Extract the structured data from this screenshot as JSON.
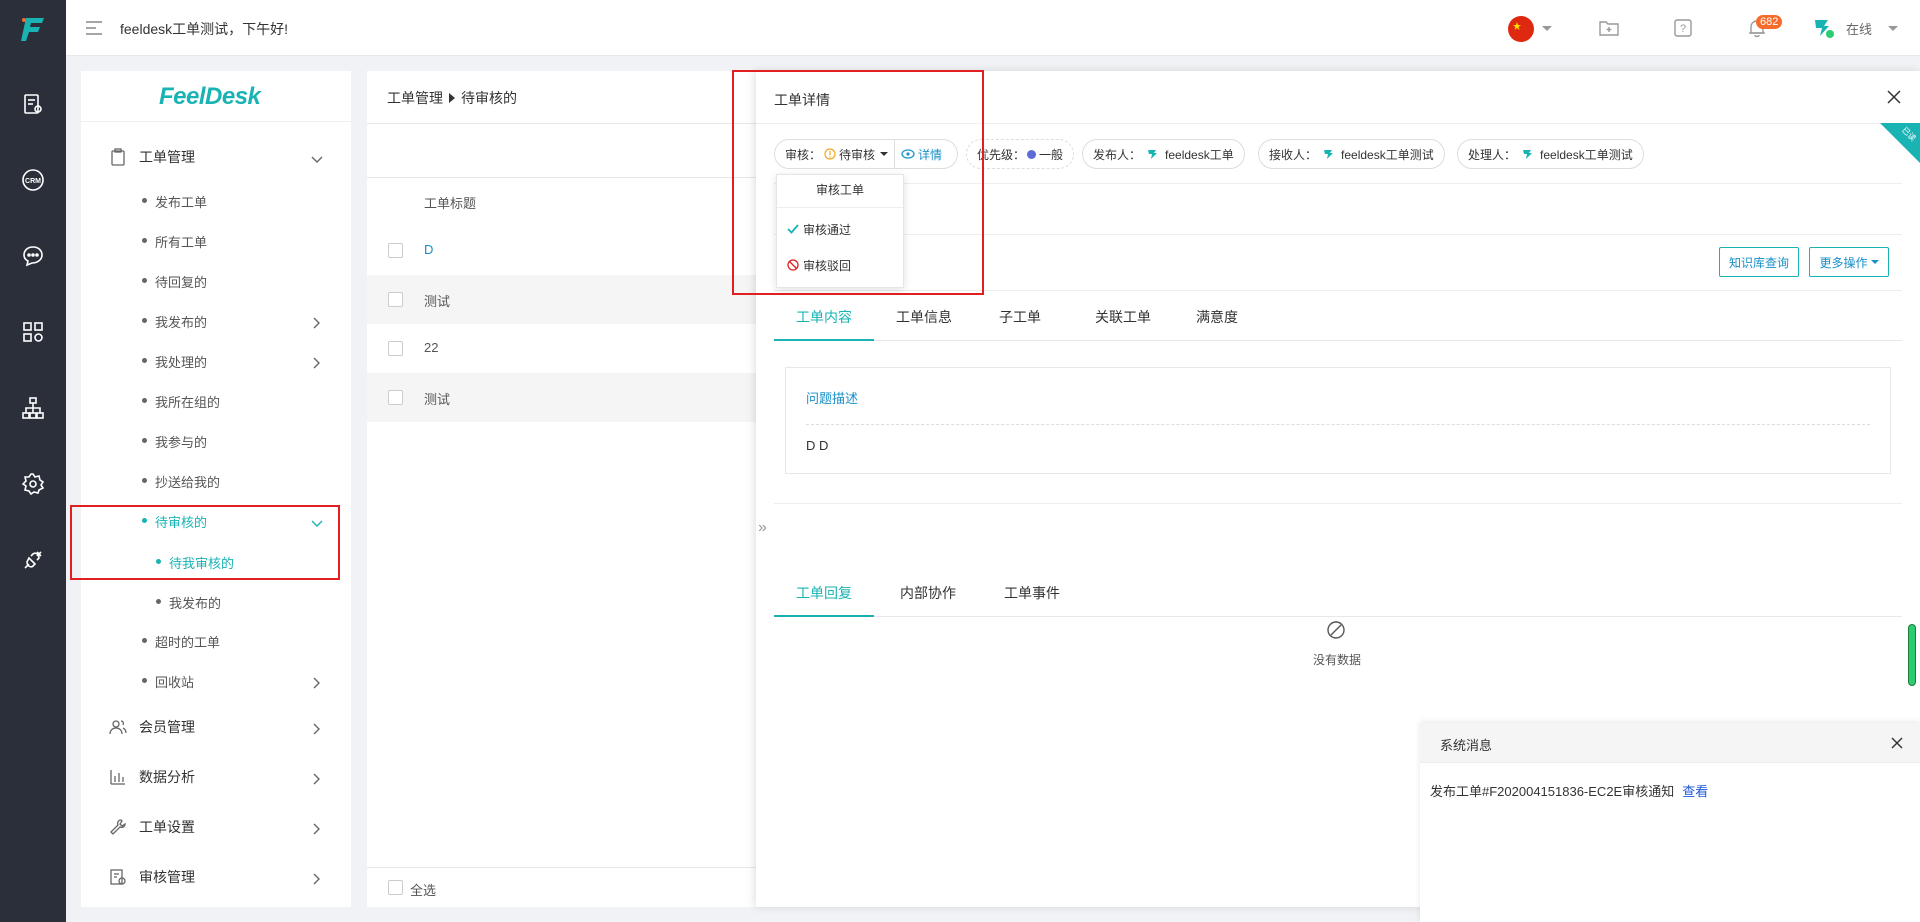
{
  "topbar": {
    "greeting": "feeldesk工单测试，下午好!",
    "notification_count": "682",
    "status": "在线"
  },
  "sidebar": {
    "brand": "FeelDesk",
    "groups": [
      {
        "label": "工单管理"
      },
      {
        "label": "会员管理"
      },
      {
        "label": "数据分析"
      },
      {
        "label": "工单设置"
      },
      {
        "label": "审核管理"
      }
    ],
    "items": [
      {
        "label": "发布工单"
      },
      {
        "label": "所有工单"
      },
      {
        "label": "待回复的"
      },
      {
        "label": "我发布的"
      },
      {
        "label": "我处理的"
      },
      {
        "label": "我所在组的"
      },
      {
        "label": "我参与的"
      },
      {
        "label": "抄送给我的"
      },
      {
        "label": "待审核的"
      },
      {
        "label": "待我审核的"
      },
      {
        "label": "我发布的"
      },
      {
        "label": "超时的工单"
      },
      {
        "label": "回收站"
      }
    ]
  },
  "list": {
    "breadcrumb_root": "工单管理",
    "breadcrumb_current": "待审核的",
    "column_title": "工单标题",
    "rows": [
      "D",
      "测试",
      "22",
      "测试"
    ],
    "select_all": "全选"
  },
  "drawer": {
    "title": "工单详情",
    "corner": "已读",
    "audit_label": "审核：",
    "audit_value": "待审核",
    "detail_link": "详情",
    "priority_label": "优先级：",
    "priority_value": "一般",
    "publisher_label": "发布人：",
    "publisher_value": "feeldesk工单",
    "receiver_label": "接收人：",
    "receiver_value": "feeldesk工单测试",
    "handler_label": "处理人：",
    "handler_value": "feeldesk工单测试",
    "kb_button": "知识库查询",
    "more_button": "更多操作",
    "tabs": [
      "工单内容",
      "工单信息",
      "子工单",
      "关联工单",
      "满意度"
    ],
    "question_label": "问题描述",
    "question_value": "D D",
    "reply_tabs": [
      "工单回复",
      "内部协作",
      "工单事件"
    ],
    "empty_text": "没有数据"
  },
  "popover": {
    "header": "审核工单",
    "approve": "审核通过",
    "reject": "审核驳回"
  },
  "sysmsg": {
    "title": "系统消息",
    "body": "发布工单#F202004151836-EC2E审核通知",
    "view": "查看"
  },
  "colors": {
    "accent": "#19b3b3",
    "rail": "#2b2f3a",
    "highlight": "#e02020",
    "link": "#1890c8"
  }
}
